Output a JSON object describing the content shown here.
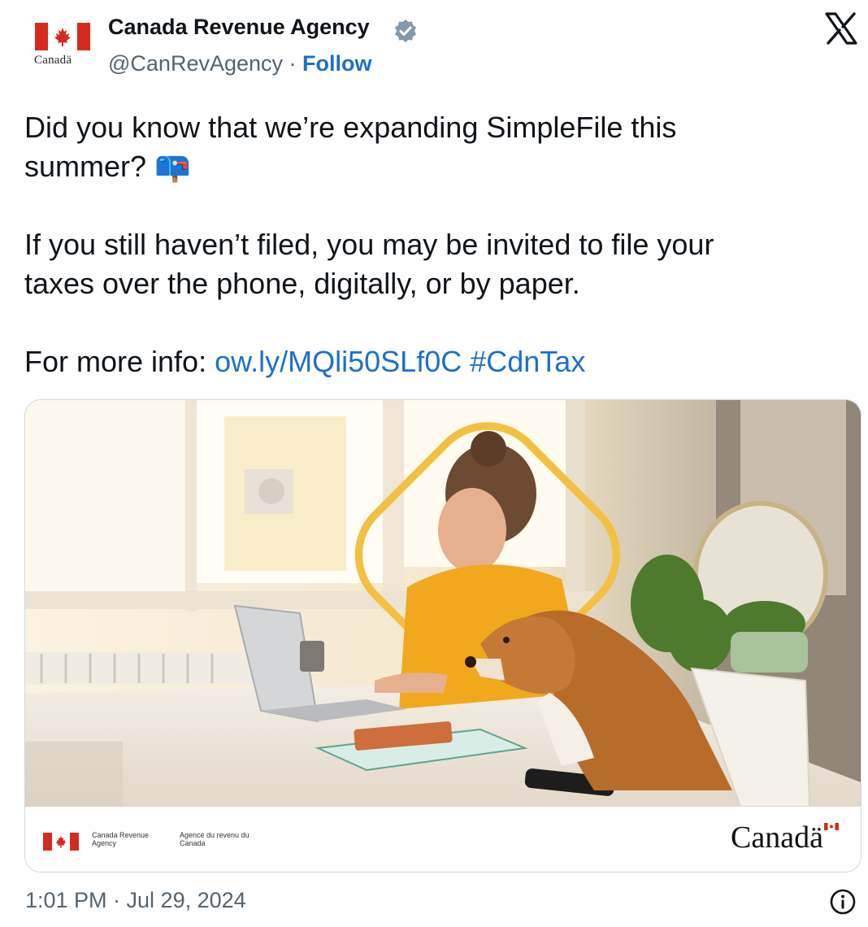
{
  "account": {
    "display_name": "Canada Revenue Agency",
    "handle": "@CanRevAgency",
    "separator": "·",
    "follow_label": "Follow",
    "logo_wordmark": "Canadä",
    "verified_icon": "verified-badge-icon"
  },
  "tweet": {
    "line1": "Did you know that we’re expanding SimpleFile this",
    "line2_text": "summer?",
    "line2_emoji": "📪",
    "line3": "If you still haven’t filed, you may be invited to file your",
    "line4": "taxes over the phone, digitally, or by paper.",
    "more_info_label": "For more info:",
    "link": "ow.ly/MQli50SLf0C",
    "hashtag": "#CdnTax"
  },
  "media": {
    "footer_en": "Canada Revenue Agency",
    "footer_fr": "Agence du revenu du Canada",
    "footer_wordmark": "Canadä",
    "colors": {
      "shirt": "#f2a81d",
      "ring": "#f4c042",
      "flag_red": "#d52b1e"
    }
  },
  "footer": {
    "timestamp": "1:01 PM · Jul 29, 2024",
    "info_icon": "info-icon"
  },
  "brand": {
    "x_logo": "x-logo-icon"
  }
}
